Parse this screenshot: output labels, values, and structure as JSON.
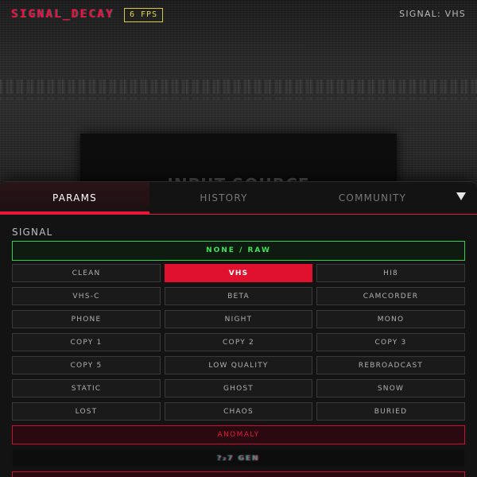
{
  "header": {
    "brand": "SIGNAL_DECAY",
    "fps": "6 FPS",
    "signal_status": "SIGNAL: VHS"
  },
  "preview": {
    "input_label": "INPUT SOURCE"
  },
  "tabs": [
    {
      "label": "PARAMS",
      "active": true
    },
    {
      "label": "HISTORY",
      "active": false
    },
    {
      "label": "COMMUNITY",
      "active": false
    }
  ],
  "icons": {
    "collapse": "triangle-down-icon"
  },
  "section": {
    "label": "SIGNAL"
  },
  "presets": {
    "none_raw": "NONE / RAW",
    "grid": [
      [
        "CLEAN",
        "VHS",
        "HI8"
      ],
      [
        "VHS-C",
        "BETA",
        "CAMCORDER"
      ],
      [
        "PHONE",
        "NIGHT",
        "MONO"
      ],
      [
        "COPY 1",
        "COPY 2",
        "COPY 3"
      ],
      [
        "COPY 5",
        "LOW QUALITY",
        "REBROADCAST"
      ],
      [
        "STATIC",
        "GHOST",
        "SNOW"
      ],
      [
        "LOST",
        "CHAOS",
        "BURIED"
      ]
    ],
    "selected": "VHS",
    "anomaly": "ANOMALY",
    "glitch_text": "?₂7 GEN"
  },
  "colors": {
    "accent": "#e8173a",
    "selected_bg": "#e0112f",
    "raw_green": "#3ee35c",
    "fps_yellow": "#e6d84a"
  }
}
